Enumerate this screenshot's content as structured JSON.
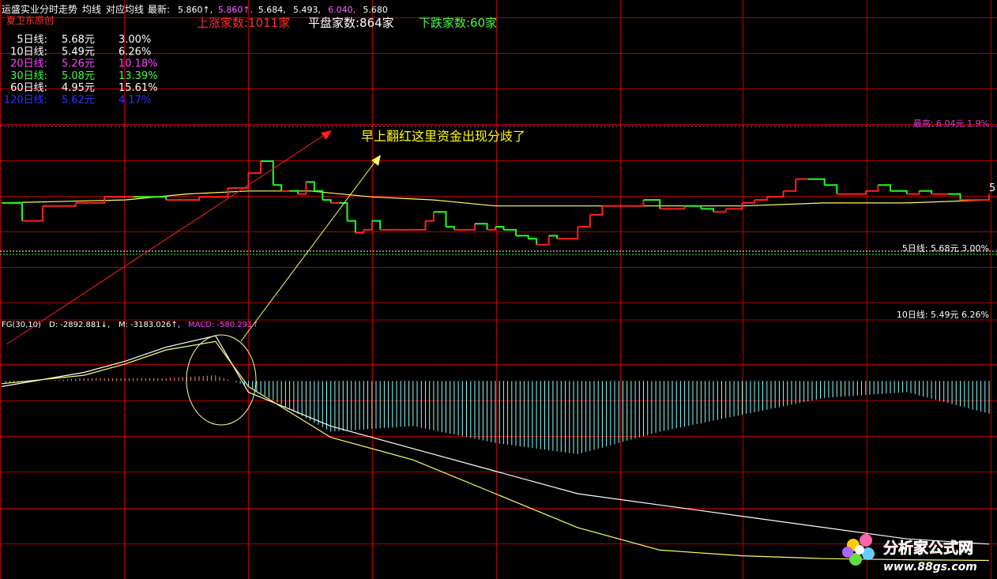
{
  "header": {
    "title": "运盛实业分时走势",
    "avg_line": "均线",
    "corr_avg_line": "对应均线",
    "latest_label": "最新:",
    "quotes": [
      {
        "text": "5.860↑",
        "color": "#ffffff"
      },
      {
        "text": "5.860↑",
        "color": "#ff66ff"
      },
      {
        "text": "5.684",
        "color": "#ffffff"
      },
      {
        "text": "5.493",
        "color": "#ffffff"
      },
      {
        "text": "6.040",
        "color": "#ff66ff"
      },
      {
        "text": "5.680",
        "color": "#ffffff"
      }
    ],
    "quote_sep": ","
  },
  "breadth": {
    "up": "上涨家数:1011家",
    "flat": "平盘家数:864家",
    "down": "下跌家数:60家"
  },
  "source_label": "夏卫东原创",
  "ma_list": [
    {
      "label": "5日线:",
      "price": "5.68元",
      "pct": "3.00%",
      "color": "#ffffff"
    },
    {
      "label": "10日线:",
      "price": "5.49元",
      "pct": "6.26%",
      "color": "#ffffff"
    },
    {
      "label": "20日线:",
      "price": "5.26元",
      "pct": "10.18%",
      "color": "#ff44ff"
    },
    {
      "label": "30日线:",
      "price": "5.08元",
      "pct": "13.39%",
      "color": "#44ff44"
    },
    {
      "label": "60日线:",
      "price": "4.95元",
      "pct": "15.61%",
      "color": "#ffffff"
    },
    {
      "label": "120日线:",
      "price": "5.62元",
      "pct": "4.17%",
      "color": "#3333ff"
    }
  ],
  "annotation": "早上翻红这里资金出现分歧了",
  "right_labels": {
    "high": "最高: 6.04元  1.9%",
    "ma5": "5日线:  5.68元  3.00%",
    "ma10": "10日线:  5.49元  6.26%",
    "axis_edge": "5"
  },
  "indicator": {
    "name": "FG(30,10)",
    "d": "D: -2892.881↓,",
    "m": "M: -3183.026↑,",
    "macd": "MACD: -580.291↑"
  },
  "watermark": {
    "name": "分析家公式网",
    "url": "www.88gs.com"
  },
  "colors": {
    "background": "#000000",
    "grid": "#b00000",
    "up": "#ff2020",
    "down": "#20ff20",
    "avg": "#ffff66",
    "d_line": "#ffffff",
    "m_line": "#ffff66",
    "macd_pos": "#ff8866",
    "macd_neg": "#88ffff",
    "annotation": "#ffff00",
    "arrow_red": "#ff2020"
  },
  "chart_data": [
    {
      "type": "line",
      "panel": "intraday",
      "title": "运盛实业分时走势",
      "series": [
        {
          "name": "",
          "x": [
            0,
            5,
            10,
            18,
            25,
            32,
            40,
            48,
            55,
            60,
            63,
            66,
            68,
            70,
            72,
            74,
            76,
            78,
            80,
            82,
            84,
            86,
            88,
            90,
            92,
            95,
            100,
            103,
            105,
            108,
            110,
            112,
            115,
            118,
            120,
            122,
            125,
            128,
            130,
            133,
            135,
            138,
            140,
            143,
            146,
            150,
            153,
            156,
            160,
            163,
            166,
            170,
            173,
            176,
            180,
            183,
            186,
            190,
            193,
            196,
            200,
            203,
            206,
            210,
            213,
            216,
            220,
            223,
            226,
            230,
            233,
            236,
            240
          ],
          "values": [
            5.72,
            5.66,
            5.71,
            5.72,
            5.74,
            5.74,
            5.73,
            5.74,
            5.77,
            5.82,
            5.86,
            5.78,
            5.76,
            5.76,
            5.75,
            5.79,
            5.76,
            5.73,
            5.72,
            5.72,
            5.66,
            5.62,
            5.63,
            5.66,
            5.63,
            5.63,
            5.63,
            5.66,
            5.69,
            5.64,
            5.63,
            5.63,
            5.65,
            5.63,
            5.64,
            5.63,
            5.61,
            5.6,
            5.58,
            5.61,
            5.6,
            5.6,
            5.64,
            5.68,
            5.71,
            5.71,
            5.71,
            5.73,
            5.7,
            5.7,
            5.71,
            5.7,
            5.69,
            5.7,
            5.72,
            5.73,
            5.74,
            5.76,
            5.8,
            5.8,
            5.78,
            5.75,
            5.75,
            5.76,
            5.78,
            5.76,
            5.75,
            5.76,
            5.75,
            5.75,
            5.73,
            5.73,
            5.75
          ]
        },
        {
          "name": "",
          "x": [
            0,
            30,
            45,
            60,
            75,
            90,
            105,
            120,
            140,
            160,
            180,
            200,
            220,
            240
          ],
          "values": [
            5.72,
            5.73,
            5.75,
            5.76,
            5.76,
            5.74,
            5.73,
            5.71,
            5.71,
            5.71,
            5.71,
            5.72,
            5.72,
            5.73
          ]
        }
      ]
    },
    {
      "type": "line",
      "panel": "indicator",
      "title": "FG(30,10)",
      "series": [
        {
          "name": "D",
          "x": [
            0,
            20,
            30,
            40,
            52,
            60,
            80,
            100,
            120,
            140,
            160,
            180,
            200,
            220,
            240
          ],
          "values": [
            -100,
            150,
            350,
            600,
            800,
            -200,
            -800,
            -1200,
            -1600,
            -2000,
            -2200,
            -2400,
            -2600,
            -2800,
            -2892.881
          ]
        },
        {
          "name": "M",
          "x": [
            0,
            20,
            30,
            40,
            52,
            60,
            80,
            100,
            120,
            140,
            160,
            180,
            200,
            220,
            240
          ],
          "values": [
            -50,
            100,
            300,
            550,
            700,
            -100,
            -1000,
            -1400,
            -2000,
            -2600,
            -3000,
            -3100,
            -3150,
            -3170,
            -3183.026
          ]
        },
        {
          "name": "MACD",
          "x": [
            0,
            20,
            30,
            40,
            52,
            60,
            80,
            100,
            120,
            140,
            160,
            180,
            200,
            220,
            240
          ],
          "values": [
            -50,
            50,
            50,
            50,
            100,
            -100,
            -900,
            -800,
            -1100,
            -1300,
            -900,
            -600,
            -300,
            -200,
            -580.291
          ]
        }
      ]
    }
  ]
}
